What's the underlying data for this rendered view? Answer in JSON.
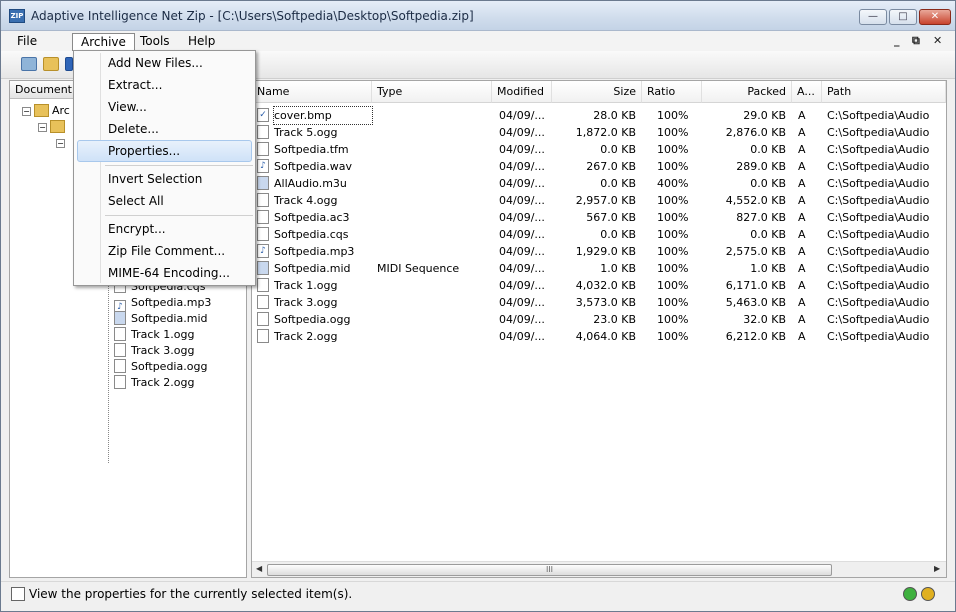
{
  "window": {
    "title": "Adaptive Intelligence Net Zip - [C:\\Users\\Softpedia\\Desktop\\Softpedia.zip]",
    "app_icon_text": "ZIP",
    "minimize": "—",
    "maximize": "□",
    "close": "✕"
  },
  "menubar": {
    "file": "File",
    "archive": "Archive",
    "tools": "Tools",
    "help": "Help",
    "mdi_minimize": "_",
    "mdi_restore": "⧉",
    "mdi_close": "✕"
  },
  "archive_menu": {
    "items": [
      "Add New Files...",
      "Extract...",
      "View...",
      "Delete...",
      "Properties...",
      "Invert Selection",
      "Select All",
      "Encrypt...",
      "Zip File Comment...",
      "MIME-64 Encoding..."
    ],
    "highlighted": "Properties..."
  },
  "left_pane": {
    "header": "Document T",
    "root_label": "Arc",
    "tree_items": [
      "Softpedia.cqs",
      "Softpedia.mp3",
      "Softpedia.mid",
      "Track 1.ogg",
      "Track 3.ogg",
      "Softpedia.ogg",
      "Track 2.ogg"
    ]
  },
  "file_list": {
    "columns": [
      "Name",
      "Type",
      "Modified",
      "Size",
      "Ratio",
      "Packed",
      "A...",
      "Path"
    ],
    "rows": [
      {
        "name": "cover.bmp",
        "type": "",
        "modified": "04/09/...",
        "size": "28.0 KB",
        "ratio": "100%",
        "packed": "29.0 KB",
        "attr": "A",
        "path": "C:\\Softpedia\\Audio",
        "icon": "image-icon"
      },
      {
        "name": "Track 5.ogg",
        "type": "",
        "modified": "04/09/...",
        "size": "1,872.0 KB",
        "ratio": "100%",
        "packed": "2,876.0 KB",
        "attr": "A",
        "path": "C:\\Softpedia\\Audio",
        "icon": "file-icon"
      },
      {
        "name": "Softpedia.tfm",
        "type": "",
        "modified": "04/09/...",
        "size": "0.0 KB",
        "ratio": "100%",
        "packed": "0.0 KB",
        "attr": "A",
        "path": "C:\\Softpedia\\Audio",
        "icon": "file-icon"
      },
      {
        "name": "Softpedia.wav",
        "type": "",
        "modified": "04/09/...",
        "size": "267.0 KB",
        "ratio": "100%",
        "packed": "289.0 KB",
        "attr": "A",
        "path": "C:\\Softpedia\\Audio",
        "icon": "audio-icon"
      },
      {
        "name": "AllAudio.m3u",
        "type": "",
        "modified": "04/09/...",
        "size": "0.0 KB",
        "ratio": "400%",
        "packed": "0.0 KB",
        "attr": "A",
        "path": "C:\\Softpedia\\Audio",
        "icon": "playlist-icon"
      },
      {
        "name": "Track 4.ogg",
        "type": "",
        "modified": "04/09/...",
        "size": "2,957.0 KB",
        "ratio": "100%",
        "packed": "4,552.0 KB",
        "attr": "A",
        "path": "C:\\Softpedia\\Audio",
        "icon": "file-icon"
      },
      {
        "name": "Softpedia.ac3",
        "type": "",
        "modified": "04/09/...",
        "size": "567.0 KB",
        "ratio": "100%",
        "packed": "827.0 KB",
        "attr": "A",
        "path": "C:\\Softpedia\\Audio",
        "icon": "file-icon"
      },
      {
        "name": "Softpedia.cqs",
        "type": "",
        "modified": "04/09/...",
        "size": "0.0 KB",
        "ratio": "100%",
        "packed": "0.0 KB",
        "attr": "A",
        "path": "C:\\Softpedia\\Audio",
        "icon": "file-icon"
      },
      {
        "name": "Softpedia.mp3",
        "type": "",
        "modified": "04/09/...",
        "size": "1,929.0 KB",
        "ratio": "100%",
        "packed": "2,575.0 KB",
        "attr": "A",
        "path": "C:\\Softpedia\\Audio",
        "icon": "audio-icon"
      },
      {
        "name": "Softpedia.mid",
        "type": "MIDI Sequence",
        "modified": "04/09/...",
        "size": "1.0 KB",
        "ratio": "100%",
        "packed": "1.0 KB",
        "attr": "A",
        "path": "C:\\Softpedia\\Audio",
        "icon": "midi-icon"
      },
      {
        "name": "Track 1.ogg",
        "type": "",
        "modified": "04/09/...",
        "size": "4,032.0 KB",
        "ratio": "100%",
        "packed": "6,171.0 KB",
        "attr": "A",
        "path": "C:\\Softpedia\\Audio",
        "icon": "file-icon"
      },
      {
        "name": "Track 3.ogg",
        "type": "",
        "modified": "04/09/...",
        "size": "3,573.0 KB",
        "ratio": "100%",
        "packed": "5,463.0 KB",
        "attr": "A",
        "path": "C:\\Softpedia\\Audio",
        "icon": "file-icon"
      },
      {
        "name": "Softpedia.ogg",
        "type": "",
        "modified": "04/09/...",
        "size": "23.0 KB",
        "ratio": "100%",
        "packed": "32.0 KB",
        "attr": "A",
        "path": "C:\\Softpedia\\Audio",
        "icon": "file-icon"
      },
      {
        "name": "Track 2.ogg",
        "type": "",
        "modified": "04/09/...",
        "size": "4,064.0 KB",
        "ratio": "100%",
        "packed": "6,212.0 KB",
        "attr": "A",
        "path": "C:\\Softpedia\\Audio",
        "icon": "file-icon"
      }
    ],
    "scroll_grip": "III"
  },
  "status": {
    "text": "View the properties for the currently selected item(s)."
  },
  "colors": {
    "accent": "#3a6fb0",
    "led_green": "#3fb13f",
    "led_yellow": "#e0b020"
  }
}
